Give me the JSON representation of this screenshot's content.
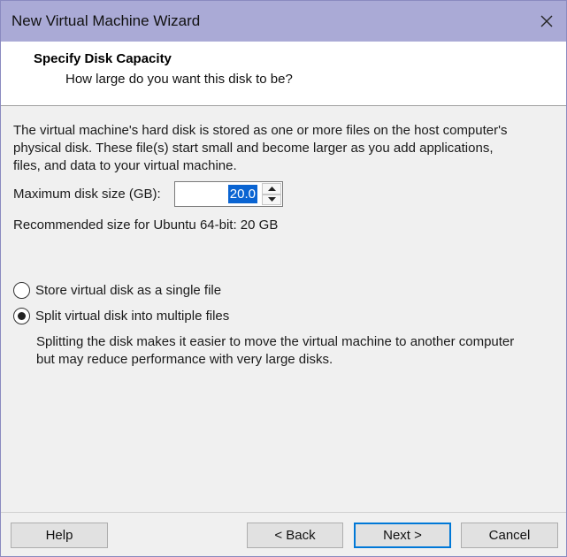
{
  "window": {
    "title": "New Virtual Machine Wizard",
    "close_icon": "close-icon"
  },
  "header": {
    "title": "Specify Disk Capacity",
    "subtitle": "How large do you want this disk to be?"
  },
  "content": {
    "description_line1": "The virtual machine's hard disk is stored as one or more files on the host computer's",
    "description_line2": "physical disk. These file(s) start small and become larger as you add applications,",
    "description_line3": "files, and data to your virtual machine.",
    "max_disk_label": "Maximum disk size (GB):",
    "max_disk_value": "20.0",
    "recommended": "Recommended size for Ubuntu 64-bit: 20 GB",
    "option_single": "Store virtual disk as a single file",
    "option_split": "Split virtual disk into multiple files",
    "selected_option": "split",
    "split_desc_line1": "Splitting the disk makes it easier to move the virtual machine to another computer",
    "split_desc_line2": "but may reduce performance with very large disks."
  },
  "buttons": {
    "help": "Help",
    "back": "< Back",
    "next": "Next >",
    "cancel": "Cancel"
  },
  "colors": {
    "titlebar": "#aaaad6",
    "selection": "#0a64d2",
    "default_button_border": "#0078d7"
  }
}
